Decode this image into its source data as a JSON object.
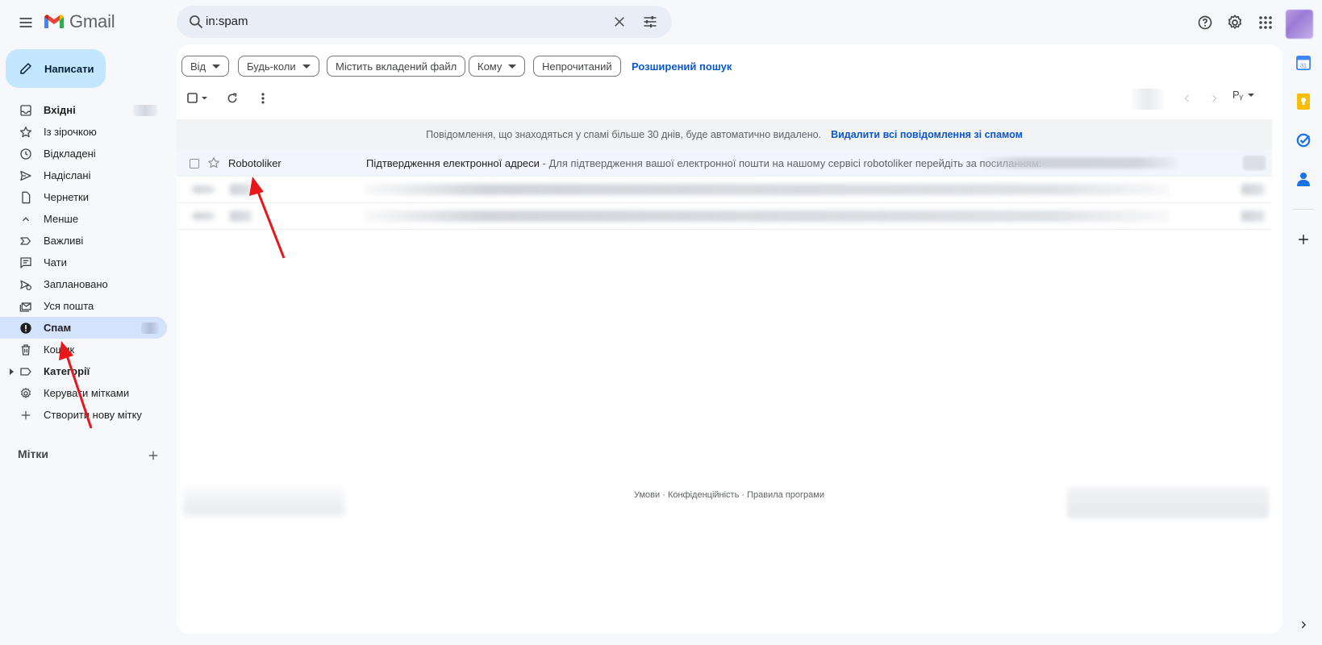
{
  "app": {
    "name": "Gmail"
  },
  "search": {
    "query": "in:spam"
  },
  "sidebar": {
    "compose_label": "Написати",
    "items": [
      {
        "label": "Вхідні",
        "icon": "inbox-icon",
        "bold": true
      },
      {
        "label": "Із зірочкою",
        "icon": "star-icon"
      },
      {
        "label": "Відкладені",
        "icon": "clock-icon"
      },
      {
        "label": "Надіслані",
        "icon": "send-icon"
      },
      {
        "label": "Чернетки",
        "icon": "draft-icon"
      },
      {
        "label": "Менше",
        "icon": "chevron-up-icon"
      },
      {
        "label": "Важливі",
        "icon": "important-icon"
      },
      {
        "label": "Чати",
        "icon": "chat-icon"
      },
      {
        "label": "Заплановано",
        "icon": "scheduled-icon"
      },
      {
        "label": "Уся пошта",
        "icon": "all-mail-icon"
      },
      {
        "label": "Спам",
        "icon": "spam-icon",
        "bold": true,
        "active": true
      },
      {
        "label": "Кошик",
        "icon": "trash-icon"
      },
      {
        "label": "Категорії",
        "icon": "label-icon",
        "bold": true
      },
      {
        "label": "Керувати мітками",
        "icon": "gear-icon"
      },
      {
        "label": "Створити нову мітку",
        "icon": "plus-icon"
      }
    ],
    "labels_heading": "Мітки"
  },
  "filters": {
    "from": "Від",
    "any_time": "Будь-коли",
    "has_attachment": "Містить вкладений файл",
    "to": "Кому",
    "unread": "Непрочитаний",
    "advanced_search": "Розширений пошук"
  },
  "toolbar": {
    "lang": "Рᵧ"
  },
  "notice": {
    "message": "Повідомлення, що знаходяться у спамі більше 30 днів, буде автоматично видалено.",
    "action": "Видалити всі повідомлення зі спамом"
  },
  "emails": [
    {
      "sender": "Robotoliker",
      "subject": "Підтвердження електронної адреси",
      "snippet": " - Для підтвердження вашої електронної пошти на нашому сервісі robotoliker перейдіть за посиланням:"
    }
  ],
  "footer": {
    "links": "Умови · Конфіденційність · Правила програми"
  },
  "colors": {
    "accent": "#0b57d0",
    "compose_bg": "#c2e7ff",
    "active_nav": "#d3e3fd",
    "annotation_arrow": "#e8161b"
  }
}
